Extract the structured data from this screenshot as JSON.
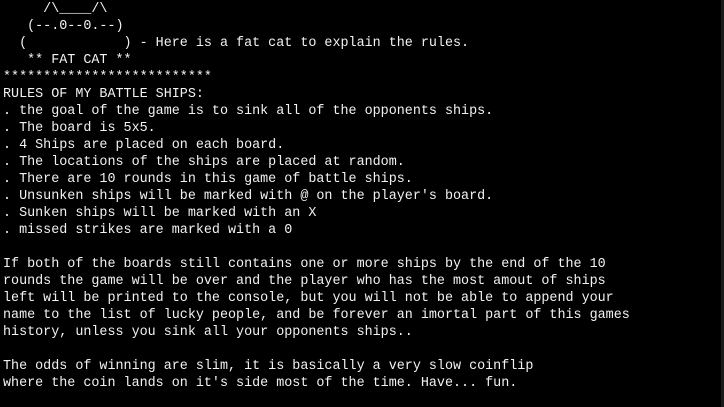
{
  "theme": {
    "background": "#000000",
    "foreground": "#f2f2f2"
  },
  "cat_art": {
    "ears": "     /\\____/\\",
    "face": "   (--.0--0.--)",
    "body": "  (            ) - Here is a fat cat to explain the rules.",
    "name": "   ** FAT CAT **"
  },
  "separator": "**************************",
  "rules": {
    "heading": "RULES OF MY BATTLE SHIPS:",
    "items": [
      ". the goal of the game is to sink all of the opponents ships.",
      ". The board is 5x5.",
      ". 4 Ships are placed on each board.",
      ". The locations of the ships are placed at random.",
      ". There are 10 rounds in this game of battle ships.",
      ". Unsunken ships will be marked with @ on the player's board.",
      ". Sunken ships will be marked with an X",
      ". missed strikes are marked with a 0"
    ]
  },
  "paragraph1": [
    "If both of the boards still contains one or more ships by the end of the 10",
    "rounds the game will be over and the player who has the most amout of ships",
    "left will be printed to the console, but you will not be able to append your",
    "name to the list of lucky people, and be forever an imortal part of this games",
    "history, unless you sink all your opponents ships.."
  ],
  "paragraph2": [
    "The odds of winning are slim, it is basically a very slow coinflip",
    "where the coin lands on it's side most of the time. Have... fun."
  ]
}
